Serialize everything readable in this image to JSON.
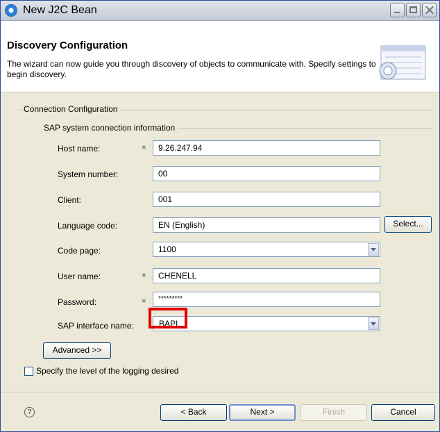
{
  "window": {
    "title": "New J2C Bean"
  },
  "banner": {
    "title": "Discovery Configuration",
    "description": "The wizard can now guide you through discovery of objects to communicate with. Specify settings to begin discovery."
  },
  "connection_group": {
    "legend": "Connection Configuration",
    "sap_group": {
      "legend": "SAP system connection information",
      "fields": {
        "host_name": {
          "label": "Host name:",
          "required": "*",
          "value": "9.26.247.94"
        },
        "system_number": {
          "label": "System number:",
          "value": "00"
        },
        "client": {
          "label": "Client:",
          "value": "001"
        },
        "language_code": {
          "label": "Language code:",
          "value": "EN (English)",
          "button_label": "Select..."
        },
        "code_page": {
          "label": "Code page:",
          "value": "1100"
        },
        "user_name": {
          "label": "User name:",
          "required": "*",
          "value": "CHENELL"
        },
        "password": {
          "label": "Password:",
          "required": "*",
          "value": "*********"
        },
        "sap_interface_name": {
          "label": "SAP interface name:",
          "value": "BAPI"
        }
      }
    },
    "advanced_button": "Advanced >>"
  },
  "logging": {
    "checkbox_label": "Specify the level of the logging desired",
    "checked": false
  },
  "footer": {
    "help_glyph": "?",
    "back": "< Back",
    "next": "Next >",
    "finish": "Finish",
    "cancel": "Cancel"
  },
  "colors": {
    "highlight": "#e00000",
    "window_bg": "#ece9d8"
  }
}
